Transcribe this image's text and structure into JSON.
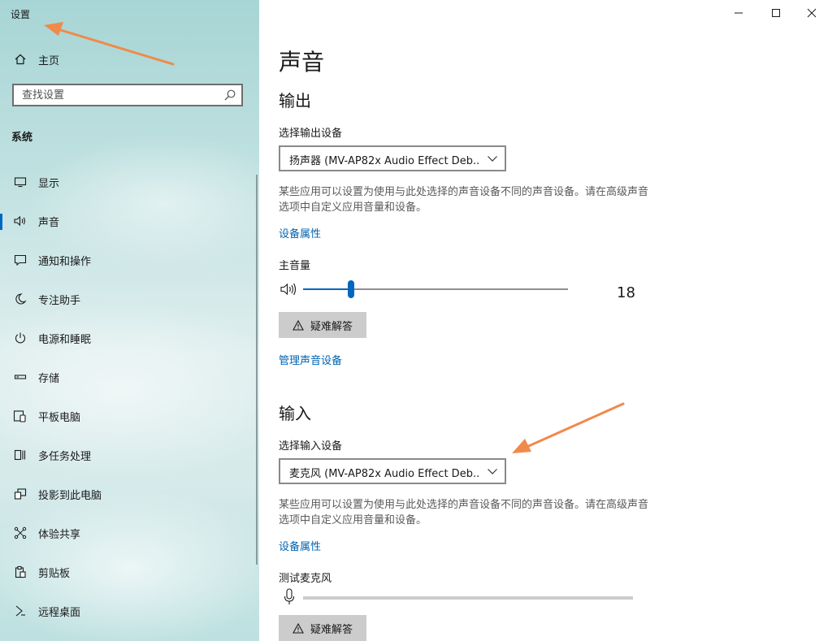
{
  "window": {
    "title": "设置"
  },
  "sidebar": {
    "home_label": "主页",
    "search_placeholder": "查找设置",
    "section_title": "系统",
    "items": [
      {
        "label": "显示",
        "icon": "monitor-icon"
      },
      {
        "label": "声音",
        "icon": "speaker-icon",
        "active": true
      },
      {
        "label": "通知和操作",
        "icon": "notification-icon"
      },
      {
        "label": "专注助手",
        "icon": "moon-icon"
      },
      {
        "label": "电源和睡眠",
        "icon": "power-icon"
      },
      {
        "label": "存储",
        "icon": "storage-icon"
      },
      {
        "label": "平板电脑",
        "icon": "tablet-icon"
      },
      {
        "label": "多任务处理",
        "icon": "multitask-icon"
      },
      {
        "label": "投影到此电脑",
        "icon": "project-icon"
      },
      {
        "label": "体验共享",
        "icon": "share-icon"
      },
      {
        "label": "剪贴板",
        "icon": "clipboard-icon"
      },
      {
        "label": "远程桌面",
        "icon": "remote-desktop-icon"
      }
    ]
  },
  "main": {
    "page_title": "声音",
    "output": {
      "heading": "输出",
      "select_label": "选择输出设备",
      "device": "扬声器 (MV-AP82x Audio Effect Deb...",
      "description": "某些应用可以设置为使用与此处选择的声音设备不同的声音设备。请在高级声音选项中自定义应用音量和设备。",
      "device_properties_link": "设备属性",
      "volume_label": "主音量",
      "volume_value": "18",
      "volume_fraction": 0.18,
      "troubleshoot_label": "疑难解答",
      "manage_devices_link": "管理声音设备"
    },
    "input": {
      "heading": "输入",
      "select_label": "选择输入设备",
      "device": "麦克风 (MV-AP82x Audio Effect Deb...",
      "description": "某些应用可以设置为使用与此处选择的声音设备不同的声音设备。请在高级声音选项中自定义应用音量和设备。",
      "device_properties_link": "设备属性",
      "test_mic_label": "测试麦克风",
      "troubleshoot_label": "疑难解答"
    }
  },
  "colors": {
    "accent": "#0067c0",
    "link": "#0063b1",
    "annotation_arrow": "#f08a4b"
  }
}
